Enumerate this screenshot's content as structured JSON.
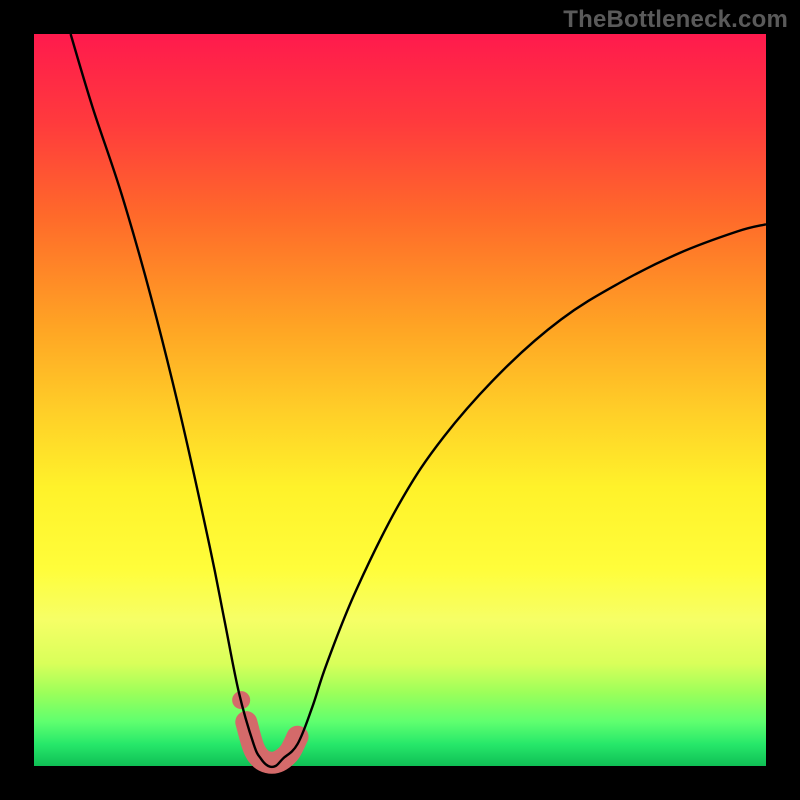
{
  "watermark": "TheBottleneck.com",
  "chart_data": {
    "type": "line",
    "title": "",
    "xlabel": "",
    "ylabel": "",
    "xlim": [
      0,
      100
    ],
    "ylim": [
      0,
      100
    ],
    "grid": false,
    "series": [
      {
        "name": "bottleneck-curve",
        "x": [
          5,
          8,
          12,
          16,
          20,
          24,
          26,
          28,
          30,
          31,
          32,
          33,
          34,
          36,
          38,
          40,
          44,
          50,
          56,
          64,
          72,
          80,
          88,
          96,
          100
        ],
        "y": [
          100,
          90,
          78,
          64,
          48,
          30,
          20,
          10,
          3,
          1,
          0,
          0,
          1,
          3,
          8,
          14,
          24,
          36,
          45,
          54,
          61,
          66,
          70,
          73,
          74
        ]
      }
    ],
    "annotations": [
      {
        "name": "trough-highlight",
        "type": "marker-band",
        "color": "#d46a6a",
        "x": [
          29,
          30,
          31,
          32,
          33,
          34,
          35,
          36
        ],
        "y": [
          6,
          2.5,
          1,
          0.5,
          0.5,
          1,
          2,
          4
        ]
      },
      {
        "name": "trough-lead-dot",
        "type": "dot",
        "color": "#d46a6a",
        "x": 28.3,
        "y": 9
      }
    ]
  }
}
